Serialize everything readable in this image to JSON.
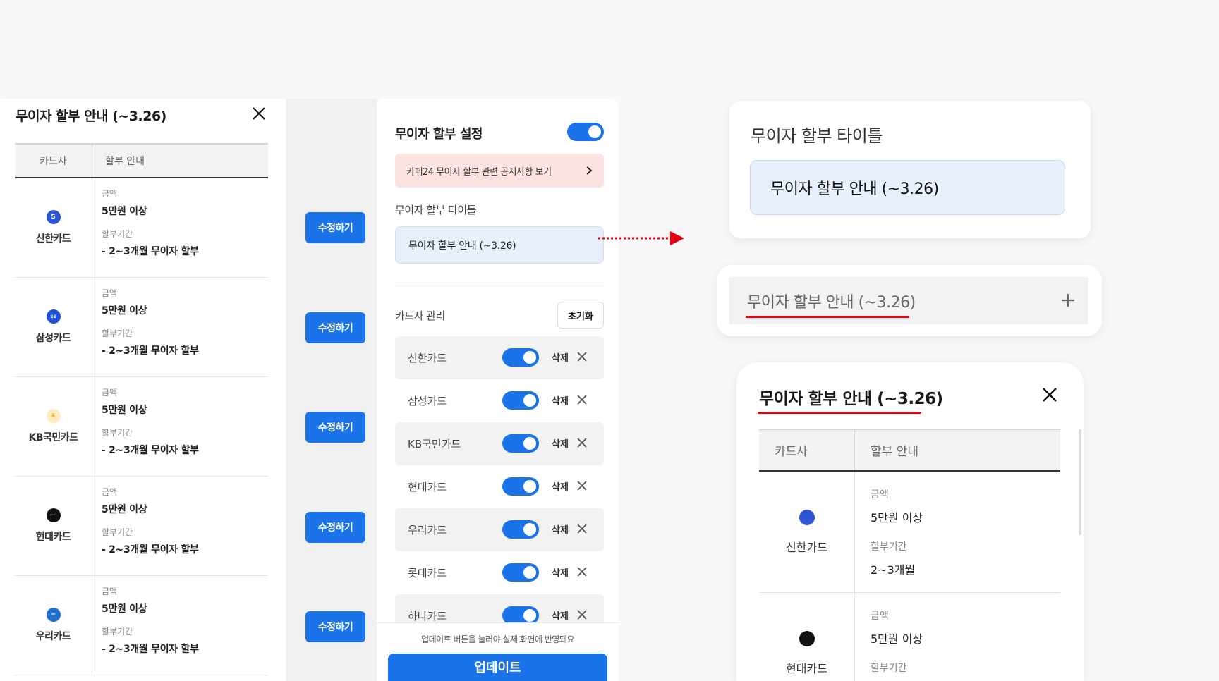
{
  "modal": {
    "title": "무이자 할부 안내 (~3.26)",
    "col_card": "카드사",
    "col_info": "할부 안내",
    "label_amount": "금액",
    "label_period": "할부기간",
    "rows": [
      {
        "card": "신한카드",
        "amount": "5만원 이상",
        "period": "- 2~3개월 무이자 할부",
        "logo_color": "#2d55d6"
      },
      {
        "card": "삼성카드",
        "amount": "5만원 이상",
        "period": "- 2~3개월 무이자 할부",
        "logo_color": "#1f4fd8"
      },
      {
        "card": "KB국민카드",
        "amount": "5만원 이상",
        "period": "- 2~3개월 무이자 할부",
        "logo_color": "#f7c948"
      },
      {
        "card": "현대카드",
        "amount": "5만원 이상",
        "period": "- 2~3개월 무이자 할부",
        "logo_color": "#111111"
      },
      {
        "card": "우리카드",
        "amount": "5만원 이상",
        "period": "- 2~3개월 무이자 할부",
        "logo_color": "#1e6fd0"
      }
    ]
  },
  "edit_button_label": "수정하기",
  "settings": {
    "title": "무이자 할부 설정",
    "notice": "카페24 무이자 할부 관련 공지사항 보기",
    "title_label": "무이자 할부 타이틀",
    "title_value": "무이자 할부 안내 (~3.26)",
    "card_manage_label": "카드사 관리",
    "reset_label": "초기화",
    "delete_label": "삭제",
    "cards": [
      "신한카드",
      "삼성카드",
      "KB국민카드",
      "현대카드",
      "우리카드",
      "롯데카드",
      "하나카드"
    ],
    "hint": "업데이트 버튼을 눌러야 실제 화면에 반영돼요",
    "update_label": "업데이트"
  },
  "preview_title_box": {
    "label": "무이자 할부 타이틀",
    "value": "무이자 할부 안내 (~3.26)"
  },
  "preview_accordion": {
    "text": "무이자 할부 안내 (~3.26)"
  },
  "preview_modal": {
    "title": "무이자 할부 안내 (~3.26)",
    "col_card": "카드사",
    "col_info": "할부 안내",
    "label_amount": "금액",
    "label_period": "할부기간",
    "rows": [
      {
        "card": "신한카드",
        "amount": "5만원 이상",
        "period": "2~3개월"
      },
      {
        "card": "현대카드",
        "amount": "5만원 이상",
        "period": ""
      }
    ]
  },
  "colors": {
    "accent": "#1a73e8",
    "highlight": "#e60012",
    "notice_bg": "#fde2e2"
  }
}
